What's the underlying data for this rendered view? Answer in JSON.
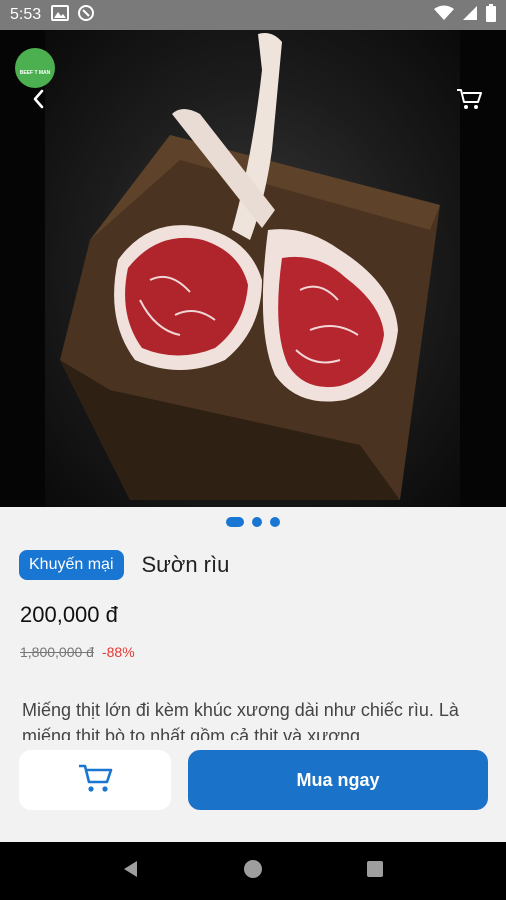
{
  "status_bar": {
    "time": "5:53"
  },
  "logo": {
    "text": "BEEF T MAN"
  },
  "hero": {
    "carousel_count": 3,
    "active_index": 0
  },
  "product": {
    "promo_label": "Khuyến mại",
    "name": "Sườn rìu",
    "price": "200,000 đ",
    "old_price": "1,800,000 đ",
    "discount": "-88%",
    "description": "Miếng thịt lớn đi kèm khúc xương dài như chiếc rìu. Là miếng thịt bò to nhất gồm cả thịt và xương"
  },
  "actions": {
    "buy_label": "Mua ngay"
  },
  "colors": {
    "accent": "#1976d2",
    "discount": "#e53935"
  }
}
